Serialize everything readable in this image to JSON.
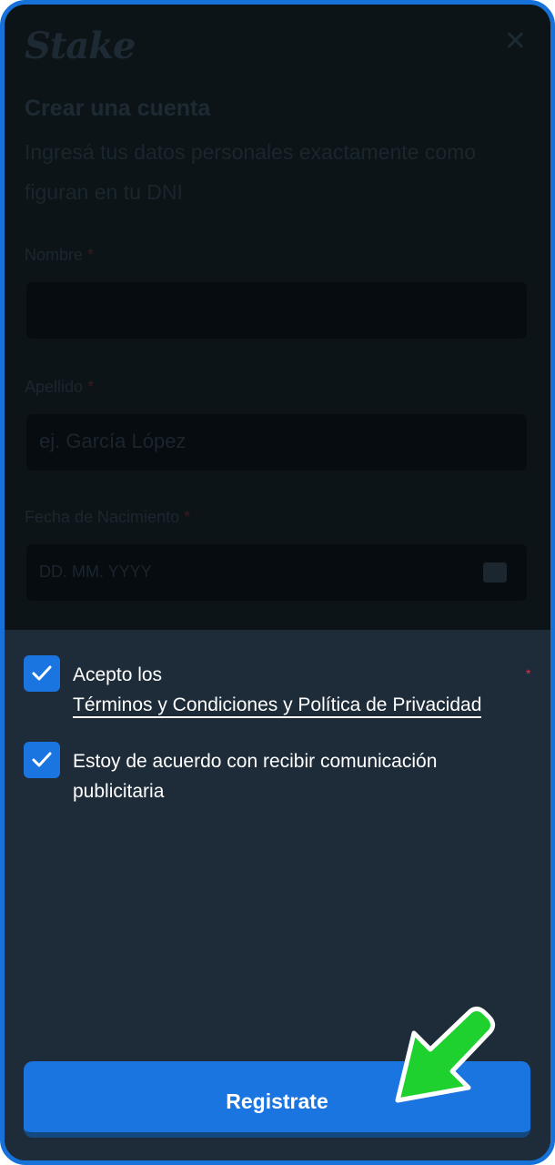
{
  "app": {
    "logo_text": "Stake"
  },
  "form": {
    "title": "Crear una cuenta",
    "subtitle": "Ingresá tus datos personales exactamente como figuran en tu DNI",
    "first_name": {
      "label": "Nombre",
      "required_mark": "*",
      "value": ""
    },
    "last_name": {
      "label": "Apellido",
      "required_mark": "*",
      "placeholder": "ej. García López"
    },
    "birthdate": {
      "label": "Fecha de Nacimiento",
      "required_mark": "*",
      "placeholder": "DD. MM. YYYY"
    }
  },
  "consents": {
    "terms": {
      "checked": true,
      "prefix": "Acepto los",
      "link_text": "Términos y Condiciones y Política de Privacidad",
      "required_mark": "*"
    },
    "marketing": {
      "checked": true,
      "text_line1": "Estoy de acuerdo con recibir comunicación",
      "text_line2": "publicitaria"
    }
  },
  "actions": {
    "register_label": "Registrate"
  },
  "colors": {
    "accent": "#1a75e0",
    "panel_bg": "#1e2c39",
    "overlay_bg": "#0d1418",
    "arrow": "#1fd12f"
  },
  "icons": [
    "close-icon",
    "check-icon",
    "calendar-icon",
    "pointer-arrow-icon"
  ]
}
